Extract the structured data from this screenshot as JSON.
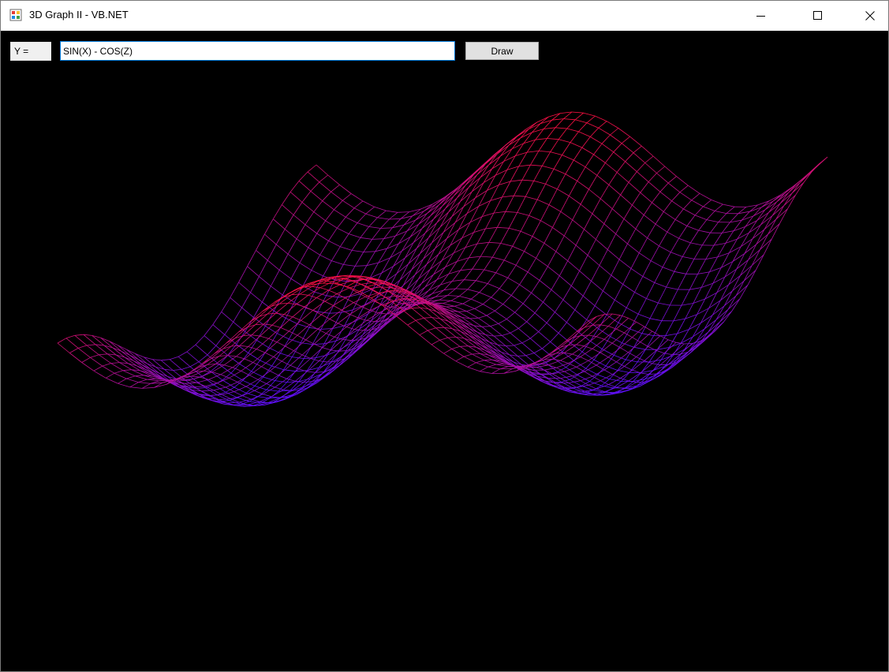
{
  "window": {
    "title": "3D Graph II - VB.NET"
  },
  "toolbar": {
    "y_label": "Y =",
    "formula_value": "SIN(X) - COS(Z)",
    "draw_label": "Draw"
  },
  "graph": {
    "function": "sin(x) - cos(z)",
    "x_range": [
      -3.14159,
      6.28318
    ],
    "z_range": [
      -3.14159,
      3.14159
    ],
    "grid_lines_x": 44,
    "grid_lines_z": 30,
    "colors": {
      "background": "#000000",
      "low": "#5a10ff",
      "high": "#ff1040"
    }
  },
  "icons": {
    "app": "app-window-icon",
    "minimize": "minimize-icon",
    "maximize": "maximize-icon",
    "close": "close-icon"
  }
}
